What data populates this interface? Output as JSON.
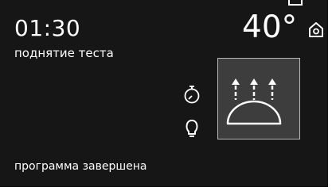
{
  "timer": "01:30",
  "program_name": "поднятие теста",
  "temperature": "40°",
  "status_message": "программа завершена",
  "icons": {
    "home": "home-icon",
    "timer": "stopwatch-icon",
    "lamp": "light-bulb-icon",
    "mode": "dough-proving-icon"
  },
  "colors": {
    "background": "#161616",
    "panel": "#3d3d3d",
    "foreground": "#ffffff"
  }
}
